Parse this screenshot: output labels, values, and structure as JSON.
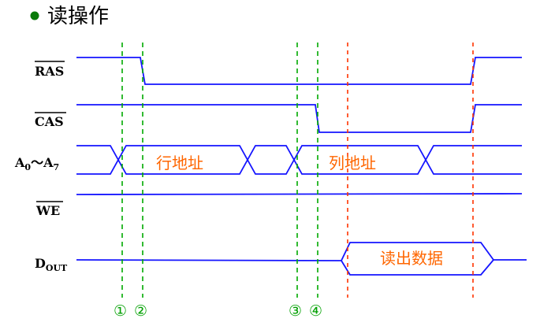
{
  "title": "读操作",
  "colors": {
    "wave": "#1414ff",
    "guide_green": "#00aa00",
    "guide_red": "#ff3300",
    "data_text": "#ff6600",
    "bullet": "#0a7a0a"
  },
  "signals": {
    "ras": "RAS",
    "cas": "CAS",
    "addr": {
      "a": "A",
      "sub0": "0",
      "tilde": "～",
      "a2": "A",
      "sub7": "7"
    },
    "we": "WE",
    "dout": {
      "d": "D",
      "sub": "OUT"
    }
  },
  "labels": {
    "row_address": "行地址",
    "col_address": "列地址",
    "read_data": "读出数据"
  },
  "markers": [
    "①",
    "②",
    "③",
    "④"
  ]
}
